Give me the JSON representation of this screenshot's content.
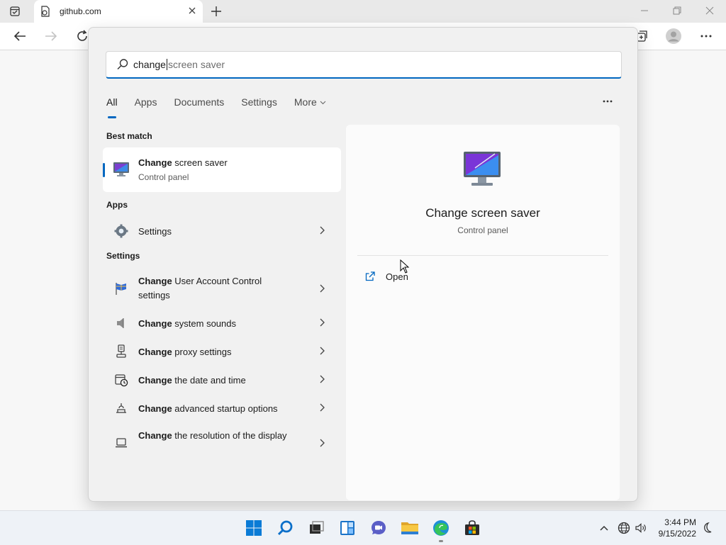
{
  "browser": {
    "tab_title": "github.com"
  },
  "search": {
    "typed_text": "change",
    "suggestion_text": "screen saver"
  },
  "filters": [
    {
      "label": "All"
    },
    {
      "label": "Apps"
    },
    {
      "label": "Documents"
    },
    {
      "label": "Settings"
    },
    {
      "label": "More"
    }
  ],
  "sections": {
    "best_match": "Best match",
    "apps": "Apps",
    "settings": "Settings"
  },
  "best_match": {
    "title_bold": "Change",
    "title_rest": " screen saver",
    "subtitle": "Control panel"
  },
  "apps": [
    {
      "label": "Settings",
      "icon": "gear-icon"
    }
  ],
  "settings": [
    {
      "bold": "Change",
      "rest": " User Account Control settings",
      "icon": "uac-flag-icon"
    },
    {
      "bold": "Change",
      "rest": " system sounds",
      "icon": "speaker-icon"
    },
    {
      "bold": "Change",
      "rest": " proxy settings",
      "icon": "proxy-icon"
    },
    {
      "bold": "Change",
      "rest": " the date and time",
      "icon": "clock-calendar-icon"
    },
    {
      "bold": "Change",
      "rest": " advanced startup options",
      "icon": "startup-icon"
    },
    {
      "bold": "Change",
      "rest": " the resolution of the display",
      "icon": "laptop-icon"
    }
  ],
  "preview": {
    "title": "Change screen saver",
    "subtitle": "Control panel",
    "open_label": "Open"
  },
  "taskbar": {
    "apps": [
      "windows-start-icon",
      "search-icon",
      "task-view-icon",
      "widgets-icon",
      "teams-chat-icon",
      "file-explorer-icon",
      "edge-icon",
      "store-icon"
    ]
  },
  "clock": {
    "time": "3:44 PM",
    "date": "9/15/2022"
  },
  "colors": {
    "accent": "#0067c0"
  }
}
